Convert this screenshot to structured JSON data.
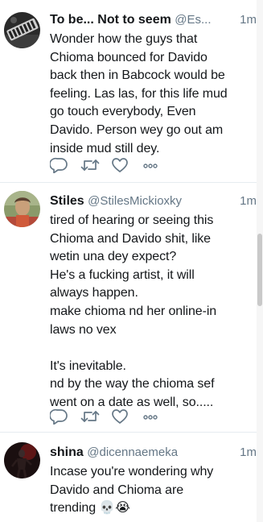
{
  "tweets": [
    {
      "display_name": "To be... Not to seem",
      "handle": "@Es...",
      "time": "1m",
      "text": "Wonder how the guys that\nChioma bounced for Davido\nback then in Babcock would be\nfeeling. Las las, for this life mud\ngo touch everybody, Even\nDavido. Person wey go out am\ninside mud still dey."
    },
    {
      "display_name": "Stiles",
      "handle": "@StilesMickioxky",
      "time": "1m",
      "text": "tired of hearing or seeing this\nChioma and Davido shit, like\nwetin una dey expect?\nHe's a fucking artist, it will\nalways happen.\nmake chioma nd her online-in\nlaws no vex\n\nIt's inevitable.\nnd by the way the chioma sef\nwent on a date as well, so....."
    },
    {
      "display_name": "shina",
      "handle": "@dicennaemeka",
      "time": "1m",
      "text": "Incase you're wondering why\nDavido and Chioma are\ntrending",
      "emojis": "💀😭"
    }
  ],
  "actions": [
    "reply-icon",
    "retweet-icon",
    "like-icon",
    "more-icon"
  ],
  "colors": {
    "text": "#14171a",
    "secondary": "#657786",
    "icon": "#657786",
    "divider": "#e6ecf0"
  }
}
